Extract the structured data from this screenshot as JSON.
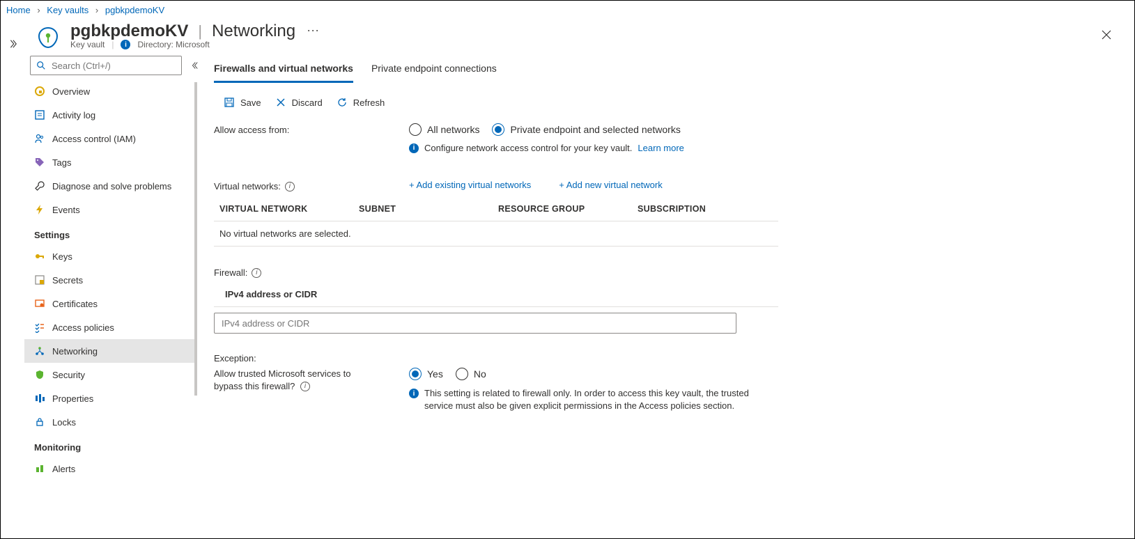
{
  "breadcrumb": {
    "home": "Home",
    "kv": "Key vaults",
    "res": "pgbkpdemoKV"
  },
  "header": {
    "resource_name": "pgbkpdemoKV",
    "page_name": "Networking",
    "resource_type": "Key vault",
    "directory": "Directory: Microsoft"
  },
  "search": {
    "placeholder": "Search (Ctrl+/)"
  },
  "nav": {
    "items": [
      {
        "label": "Overview"
      },
      {
        "label": "Activity log"
      },
      {
        "label": "Access control (IAM)"
      },
      {
        "label": "Tags"
      },
      {
        "label": "Diagnose and solve problems"
      },
      {
        "label": "Events"
      }
    ],
    "settings_label": "Settings",
    "settings": [
      {
        "label": "Keys"
      },
      {
        "label": "Secrets"
      },
      {
        "label": "Certificates"
      },
      {
        "label": "Access policies"
      },
      {
        "label": "Networking"
      },
      {
        "label": "Security"
      },
      {
        "label": "Properties"
      },
      {
        "label": "Locks"
      }
    ],
    "monitoring_label": "Monitoring",
    "monitoring": [
      {
        "label": "Alerts"
      }
    ]
  },
  "tabs": {
    "firewalls": "Firewalls and virtual networks",
    "private_ep": "Private endpoint connections"
  },
  "toolbar": {
    "save": "Save",
    "discard": "Discard",
    "refresh": "Refresh"
  },
  "access": {
    "label": "Allow access from:",
    "all": "All networks",
    "selected": "Private endpoint and selected networks",
    "info_text": "Configure network access control for your key vault.",
    "learn_more": "Learn more"
  },
  "vnets": {
    "label": "Virtual networks:",
    "add_existing": "+ Add existing virtual networks",
    "add_new": "+ Add new virtual network",
    "cols": {
      "vnet": "VIRTUAL NETWORK",
      "subnet": "SUBNET",
      "rg": "RESOURCE GROUP",
      "sub": "SUBSCRIPTION"
    },
    "empty": "No virtual networks are selected."
  },
  "firewall": {
    "label": "Firewall:",
    "col": "IPv4 address or CIDR",
    "placeholder": "IPv4 address or CIDR"
  },
  "exception": {
    "label": "Exception:",
    "question": "Allow trusted Microsoft services to bypass this firewall?",
    "yes": "Yes",
    "no": "No",
    "hint": "This setting is related to firewall only. In order to access this key vault, the trusted service must also be given explicit permissions in the Access policies section."
  }
}
